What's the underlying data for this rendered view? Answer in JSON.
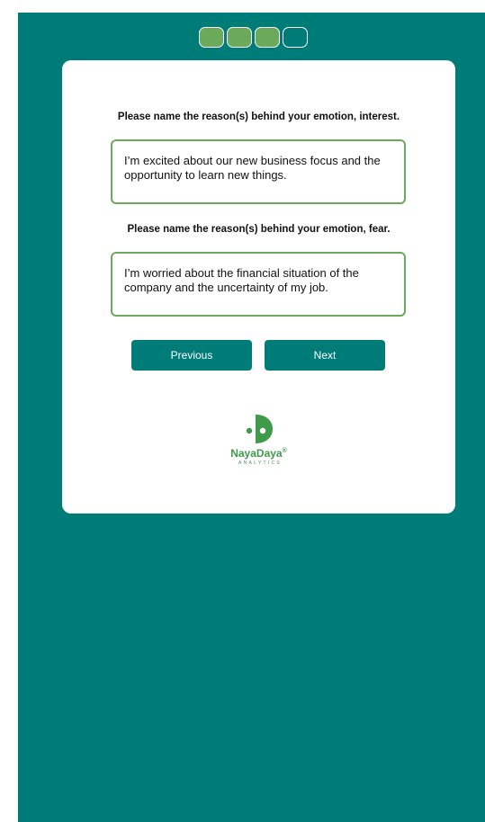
{
  "progress": {
    "total_steps": 4,
    "completed_steps": 3,
    "fill_color": "#6aaa5a"
  },
  "questions": [
    {
      "prompt": "Please name the reason(s) behind your emotion, interest.",
      "answer": "I’m excited about our new business focus and the opportunity to learn new things."
    },
    {
      "prompt": "Please name the reason(s) behind your emotion, fear.",
      "answer": "I’m worried about the financial situation of the company and the uncertainty of my job."
    }
  ],
  "buttons": {
    "previous_label": "Previous",
    "next_label": "Next"
  },
  "logo": {
    "name": "NayaDaya",
    "registered_mark": "®",
    "tagline": "ANALYTICS",
    "icon": "nayadaya-logo-icon"
  },
  "colors": {
    "background_teal": "#007c78",
    "accent_green": "#6aaa5a",
    "logo_green": "#3f9a4a"
  }
}
